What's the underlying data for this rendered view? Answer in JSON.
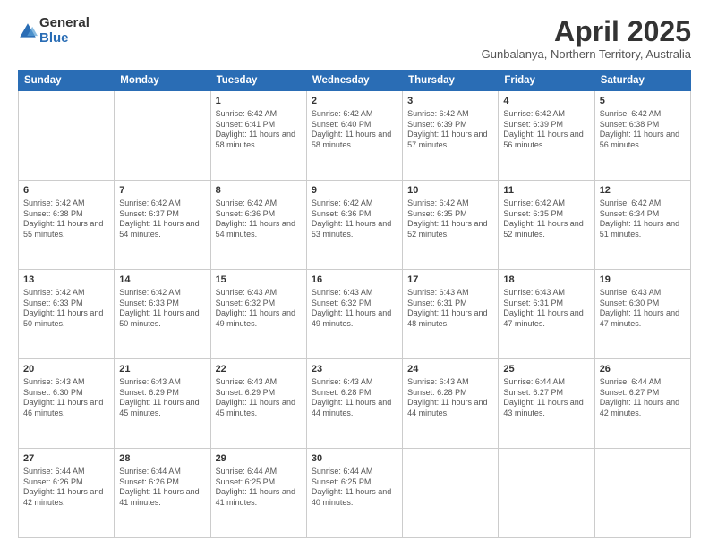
{
  "header": {
    "logo_general": "General",
    "logo_blue": "Blue",
    "month_title": "April 2025",
    "subtitle": "Gunbalanya, Northern Territory, Australia"
  },
  "days_of_week": [
    "Sunday",
    "Monday",
    "Tuesday",
    "Wednesday",
    "Thursday",
    "Friday",
    "Saturday"
  ],
  "weeks": [
    [
      {
        "day": "",
        "info": ""
      },
      {
        "day": "",
        "info": ""
      },
      {
        "day": "1",
        "info": "Sunrise: 6:42 AM\nSunset: 6:41 PM\nDaylight: 11 hours and 58 minutes."
      },
      {
        "day": "2",
        "info": "Sunrise: 6:42 AM\nSunset: 6:40 PM\nDaylight: 11 hours and 58 minutes."
      },
      {
        "day": "3",
        "info": "Sunrise: 6:42 AM\nSunset: 6:39 PM\nDaylight: 11 hours and 57 minutes."
      },
      {
        "day": "4",
        "info": "Sunrise: 6:42 AM\nSunset: 6:39 PM\nDaylight: 11 hours and 56 minutes."
      },
      {
        "day": "5",
        "info": "Sunrise: 6:42 AM\nSunset: 6:38 PM\nDaylight: 11 hours and 56 minutes."
      }
    ],
    [
      {
        "day": "6",
        "info": "Sunrise: 6:42 AM\nSunset: 6:38 PM\nDaylight: 11 hours and 55 minutes."
      },
      {
        "day": "7",
        "info": "Sunrise: 6:42 AM\nSunset: 6:37 PM\nDaylight: 11 hours and 54 minutes."
      },
      {
        "day": "8",
        "info": "Sunrise: 6:42 AM\nSunset: 6:36 PM\nDaylight: 11 hours and 54 minutes."
      },
      {
        "day": "9",
        "info": "Sunrise: 6:42 AM\nSunset: 6:36 PM\nDaylight: 11 hours and 53 minutes."
      },
      {
        "day": "10",
        "info": "Sunrise: 6:42 AM\nSunset: 6:35 PM\nDaylight: 11 hours and 52 minutes."
      },
      {
        "day": "11",
        "info": "Sunrise: 6:42 AM\nSunset: 6:35 PM\nDaylight: 11 hours and 52 minutes."
      },
      {
        "day": "12",
        "info": "Sunrise: 6:42 AM\nSunset: 6:34 PM\nDaylight: 11 hours and 51 minutes."
      }
    ],
    [
      {
        "day": "13",
        "info": "Sunrise: 6:42 AM\nSunset: 6:33 PM\nDaylight: 11 hours and 50 minutes."
      },
      {
        "day": "14",
        "info": "Sunrise: 6:42 AM\nSunset: 6:33 PM\nDaylight: 11 hours and 50 minutes."
      },
      {
        "day": "15",
        "info": "Sunrise: 6:43 AM\nSunset: 6:32 PM\nDaylight: 11 hours and 49 minutes."
      },
      {
        "day": "16",
        "info": "Sunrise: 6:43 AM\nSunset: 6:32 PM\nDaylight: 11 hours and 49 minutes."
      },
      {
        "day": "17",
        "info": "Sunrise: 6:43 AM\nSunset: 6:31 PM\nDaylight: 11 hours and 48 minutes."
      },
      {
        "day": "18",
        "info": "Sunrise: 6:43 AM\nSunset: 6:31 PM\nDaylight: 11 hours and 47 minutes."
      },
      {
        "day": "19",
        "info": "Sunrise: 6:43 AM\nSunset: 6:30 PM\nDaylight: 11 hours and 47 minutes."
      }
    ],
    [
      {
        "day": "20",
        "info": "Sunrise: 6:43 AM\nSunset: 6:30 PM\nDaylight: 11 hours and 46 minutes."
      },
      {
        "day": "21",
        "info": "Sunrise: 6:43 AM\nSunset: 6:29 PM\nDaylight: 11 hours and 45 minutes."
      },
      {
        "day": "22",
        "info": "Sunrise: 6:43 AM\nSunset: 6:29 PM\nDaylight: 11 hours and 45 minutes."
      },
      {
        "day": "23",
        "info": "Sunrise: 6:43 AM\nSunset: 6:28 PM\nDaylight: 11 hours and 44 minutes."
      },
      {
        "day": "24",
        "info": "Sunrise: 6:43 AM\nSunset: 6:28 PM\nDaylight: 11 hours and 44 minutes."
      },
      {
        "day": "25",
        "info": "Sunrise: 6:44 AM\nSunset: 6:27 PM\nDaylight: 11 hours and 43 minutes."
      },
      {
        "day": "26",
        "info": "Sunrise: 6:44 AM\nSunset: 6:27 PM\nDaylight: 11 hours and 42 minutes."
      }
    ],
    [
      {
        "day": "27",
        "info": "Sunrise: 6:44 AM\nSunset: 6:26 PM\nDaylight: 11 hours and 42 minutes."
      },
      {
        "day": "28",
        "info": "Sunrise: 6:44 AM\nSunset: 6:26 PM\nDaylight: 11 hours and 41 minutes."
      },
      {
        "day": "29",
        "info": "Sunrise: 6:44 AM\nSunset: 6:25 PM\nDaylight: 11 hours and 41 minutes."
      },
      {
        "day": "30",
        "info": "Sunrise: 6:44 AM\nSunset: 6:25 PM\nDaylight: 11 hours and 40 minutes."
      },
      {
        "day": "",
        "info": ""
      },
      {
        "day": "",
        "info": ""
      },
      {
        "day": "",
        "info": ""
      }
    ]
  ]
}
